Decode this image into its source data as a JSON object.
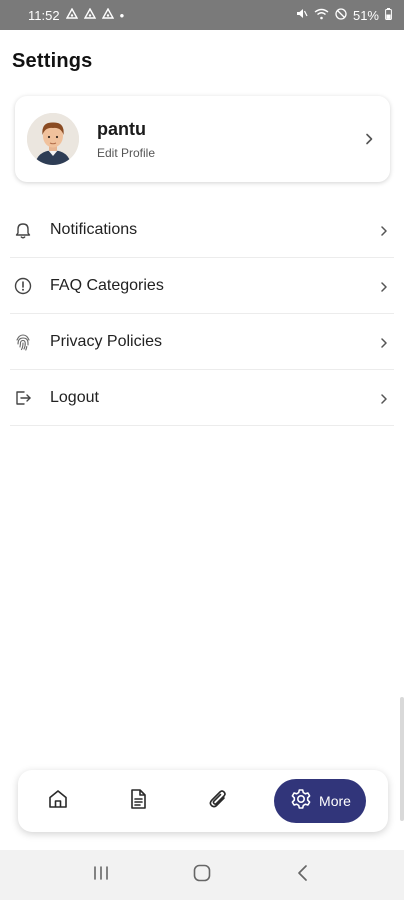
{
  "status_bar": {
    "time": "11:52",
    "left_icons": [
      "notification-icon",
      "notification-icon",
      "notification-icon"
    ],
    "dot": "•",
    "right_icons": [
      "mute-icon",
      "wifi-icon",
      "dnd-icon"
    ],
    "battery": "51%"
  },
  "header": {
    "title": "Settings"
  },
  "profile": {
    "name": "pantu",
    "subtitle": "Edit Profile"
  },
  "menu": {
    "items": [
      {
        "icon": "bell-icon",
        "label": "Notifications"
      },
      {
        "icon": "info-circle-icon",
        "label": "FAQ Categories"
      },
      {
        "icon": "fingerprint-icon",
        "label": "Privacy Policies"
      },
      {
        "icon": "logout-icon",
        "label": "Logout"
      }
    ]
  },
  "bottom_nav": {
    "items": [
      {
        "icon": "home-icon"
      },
      {
        "icon": "document-icon"
      },
      {
        "icon": "paperclip-icon"
      }
    ],
    "active": {
      "icon": "gear-icon",
      "label": "More"
    },
    "accent_color": "#31357a"
  },
  "system_nav": {
    "buttons": [
      "recents-icon",
      "home-circle-icon",
      "back-icon"
    ]
  }
}
